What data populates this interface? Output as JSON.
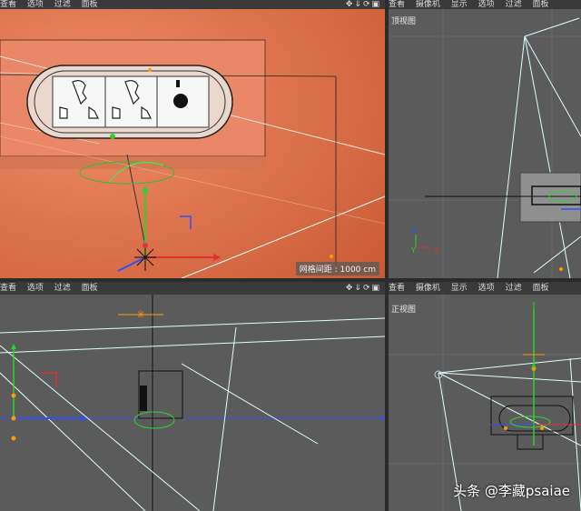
{
  "menus": {
    "top_left": [
      "查看",
      "选项",
      "过滤",
      "面板"
    ],
    "top_right": [
      "查看",
      "摄像机",
      "显示",
      "选项",
      "过滤",
      "面板"
    ],
    "bottom_left": [
      "查看",
      "选项",
      "过滤",
      "面板"
    ],
    "bottom_right": [
      "查看",
      "摄像机",
      "显示",
      "选项",
      "过滤",
      "面板"
    ]
  },
  "viewports": {
    "top_right_label": "顶视图",
    "bottom_right_label": "正视图",
    "grid_spacing": "网格间距 : 1000 cm"
  },
  "nav_icons": [
    "move-icon",
    "down-arrow-icon",
    "rotate-icon",
    "maximize-icon"
  ],
  "watermark": "头条 @李藏psaiae",
  "colors": {
    "viewport_bg": "#5b5b5b",
    "perspective_bg": "#d9704a",
    "axis_x": "#e03030",
    "axis_y": "#30d030",
    "axis_z": "#3050ff"
  }
}
